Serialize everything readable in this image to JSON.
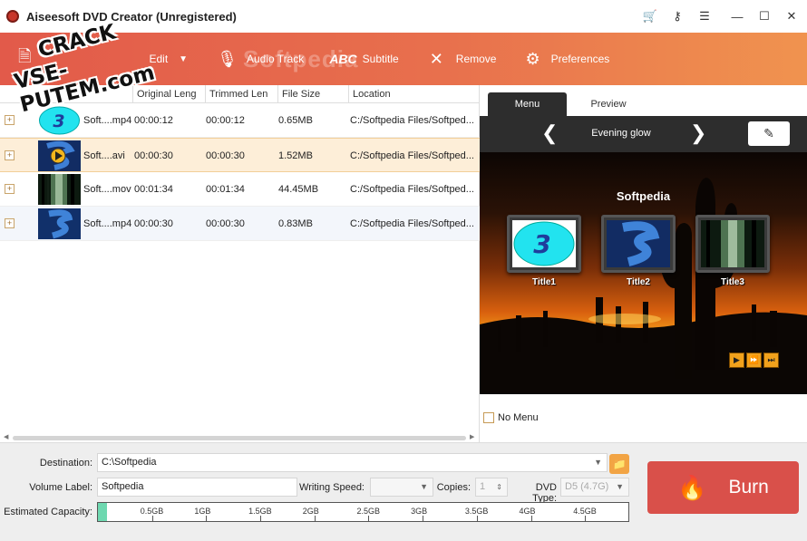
{
  "window": {
    "title": "Aiseesoft DVD Creator (Unregistered)",
    "controls": [
      "cart-icon",
      "key-icon",
      "feedback-icon",
      "minimize-icon",
      "maximize-icon",
      "close-icon"
    ]
  },
  "toolbar": {
    "edit_label": "Edit",
    "audio_track_label": "Audio Track",
    "subtitle_label": "Subtitle",
    "subtitle_icon_text": "ABC",
    "remove_label": "Remove",
    "preferences_label": "Preferences",
    "watermark_text": "Softpedia"
  },
  "stamp": {
    "line1": "CRACK",
    "line2": "VSE-PUTEM.com"
  },
  "file_list": {
    "columns": [
      "Original Leng",
      "Trimmed Len",
      "File Size",
      "Location"
    ],
    "rows": [
      {
        "name": "Soft....mp4",
        "original": "00:00:12",
        "trimmed": "00:00:12",
        "size": "0.65MB",
        "location": "C:/Softpedia Files/Softped...",
        "thumb": "cyan-3"
      },
      {
        "name": "Soft....avi",
        "original": "00:00:30",
        "trimmed": "00:00:30",
        "size": "1.52MB",
        "location": "C:/Softpedia Files/Softped...",
        "thumb": "blue-play"
      },
      {
        "name": "Soft....mov",
        "original": "00:01:34",
        "trimmed": "00:01:34",
        "size": "44.45MB",
        "location": "C:/Softpedia Files/Softped...",
        "thumb": "forest"
      },
      {
        "name": "Soft....mp4",
        "original": "00:00:30",
        "trimmed": "00:00:30",
        "size": "0.83MB",
        "location": "C:/Softpedia Files/Softped...",
        "thumb": "blue-s"
      }
    ]
  },
  "preview": {
    "tabs": [
      "Menu",
      "Preview"
    ],
    "active_tab": "Menu",
    "theme_name": "Evening glow",
    "scene_title": "Softpedia",
    "titles": [
      "Title1",
      "Title2",
      "Title3"
    ],
    "no_menu_label": "No Menu"
  },
  "bottom": {
    "destination_label": "Destination:",
    "destination_value": "C:\\Softpedia",
    "volume_label_label": "Volume Label:",
    "volume_label_value": "Softpedia",
    "writing_speed_label": "Writing Speed:",
    "writing_speed_value": "",
    "copies_label": "Copies:",
    "copies_value": "1",
    "dvd_type_label": "DVD Type:",
    "dvd_type_value": "D5 (4.7G)",
    "capacity_label": "Estimated Capacity:",
    "capacity_ticks": [
      "0.5GB",
      "1GB",
      "1.5GB",
      "2GB",
      "2.5GB",
      "3GB",
      "3.5GB",
      "4GB",
      "4.5GB"
    ],
    "capacity_used_fraction": 0.017,
    "burn_label": "Burn"
  },
  "colors": {
    "accent": "#e25a4a",
    "burn": "#d9504a",
    "selected_row": "#fdeed8",
    "capacity_fill": "#6ed8b0"
  }
}
